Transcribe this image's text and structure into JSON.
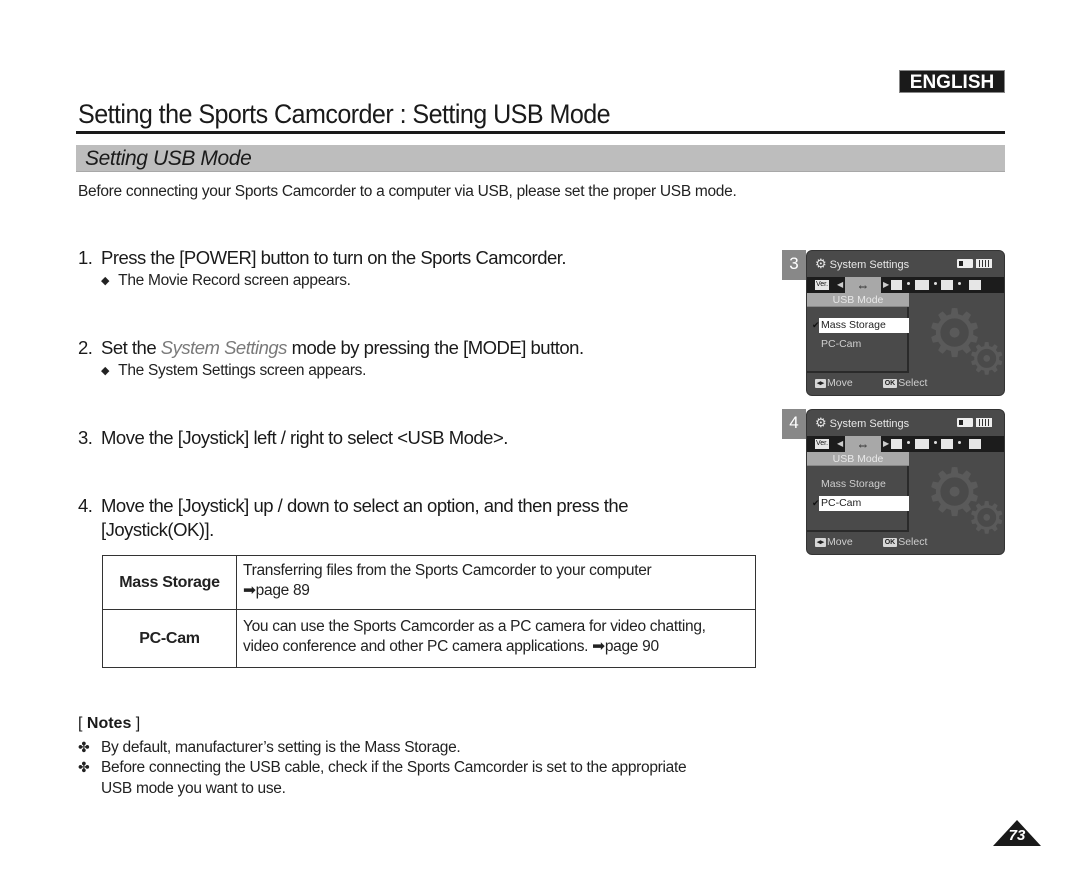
{
  "language_badge": "ENGLISH",
  "page_title": "Setting the Sports Camcorder : Setting USB Mode",
  "section_title": "Setting USB Mode",
  "intro": "Before connecting your Sports Camcorder to a computer via USB, please set the proper USB mode.",
  "steps": [
    {
      "num": "1.",
      "text": "Press the [POWER] button to turn on the Sports Camcorder.",
      "sub": "The Movie Record screen appears."
    },
    {
      "num": "2.",
      "text_before": "Set the ",
      "emph": "System Settings",
      "text_after": " mode by pressing the [MODE] button.",
      "sub": "The System Settings screen appears."
    },
    {
      "num": "3.",
      "text": "Move the [Joystick] left / right to select <USB Mode>."
    },
    {
      "num": "4.",
      "text_line1": "Move the [Joystick] up / down to select an option, and then press the",
      "text_line2": "[Joystick(OK)]."
    }
  ],
  "sub_bullet": "◆",
  "options_table": [
    {
      "name": "Mass Storage",
      "desc_line1": "Transferring files from the Sports Camcorder to your computer",
      "desc_line2": "➡page 89"
    },
    {
      "name": "PC-Cam",
      "desc_line1": "You can use the Sports Camcorder as a PC camera for video chatting,",
      "desc_line2": "video conference and other PC camera applications. ➡page 90"
    }
  ],
  "notes": {
    "title_open": "[ ",
    "title": "Notes",
    "title_close": " ]",
    "bullet": "✤",
    "items": [
      {
        "line1": "By default, manufacturer’s setting is the Mass Storage."
      },
      {
        "line1": "Before connecting the USB cable, check if the Sports Camcorder is set to the appropriate",
        "line2": "USB mode you want to use."
      }
    ]
  },
  "screens": [
    {
      "step": "3",
      "header": "System Settings",
      "icons": {
        "version": "Ver.",
        "usb": "⇔"
      },
      "menu_title": "USB Mode",
      "options": [
        "Mass Storage",
        "PC-Cam"
      ],
      "selected_index": 0,
      "check": "✔",
      "footer": {
        "move_key": "◂▸",
        "move": "Move",
        "ok_key": "OK",
        "select": "Select"
      }
    },
    {
      "step": "4",
      "header": "System Settings",
      "icons": {
        "version": "Ver.",
        "usb": "⇔"
      },
      "menu_title": "USB Mode",
      "options": [
        "Mass Storage",
        "PC-Cam"
      ],
      "selected_index": 1,
      "check": "✔",
      "footer": {
        "move_key": "◂▸",
        "move": "Move",
        "ok_key": "OK",
        "select": "Select"
      }
    }
  ],
  "page_number": "73"
}
